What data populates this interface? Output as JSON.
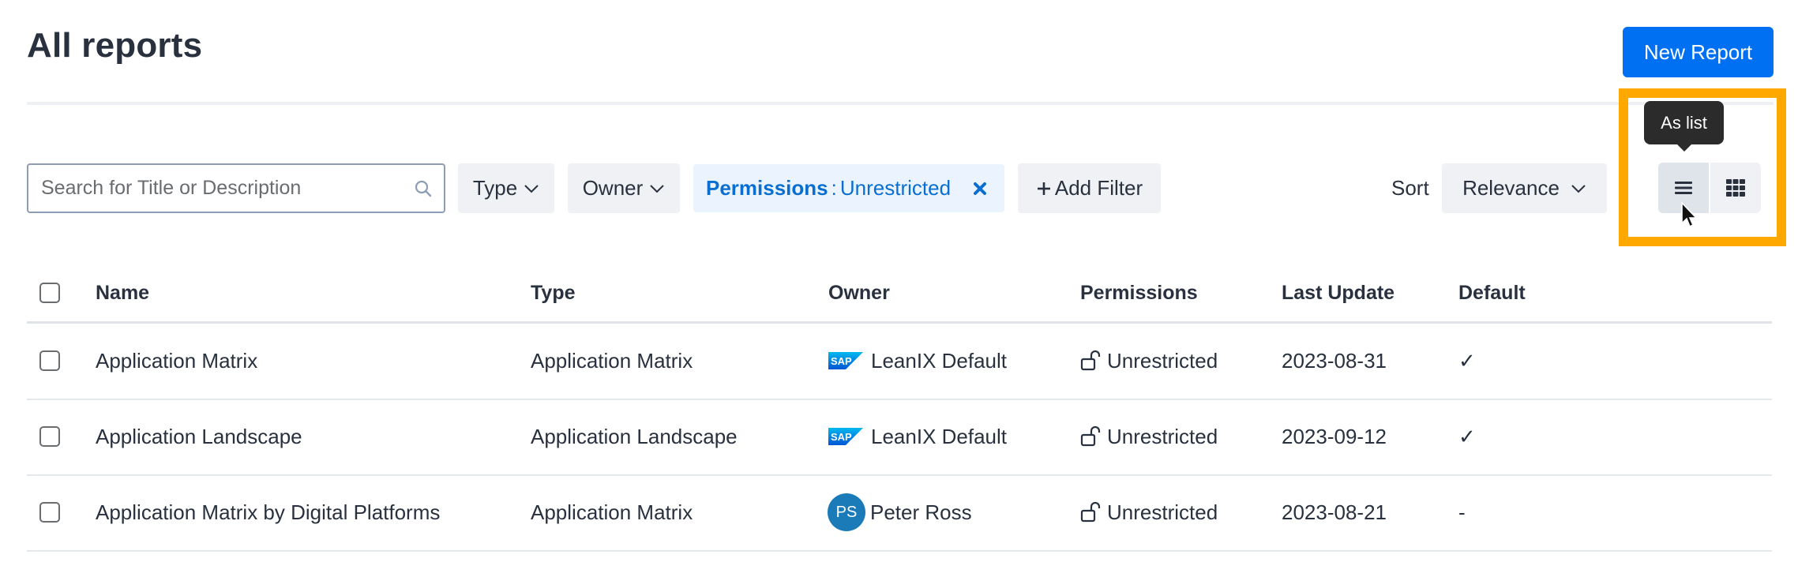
{
  "header": {
    "title": "All reports",
    "new_report_label": "New Report"
  },
  "toolbar": {
    "search_placeholder": "Search for Title or Description",
    "search_value": "",
    "type_filter_label": "Type",
    "owner_filter_label": "Owner",
    "active_filter": {
      "key": "Permissions",
      "separator": ":",
      "value": "Unrestricted"
    },
    "add_filter_label": "Add Filter",
    "sort_label": "Sort",
    "sort_value": "Relevance",
    "view_tooltip": "As list",
    "view_mode": "list",
    "icons": {
      "search": "search-icon",
      "dropdown": "chevron-down-icon",
      "remove": "close-icon",
      "add": "plus-icon",
      "list_view": "list-icon",
      "grid_view": "grid-icon"
    }
  },
  "colors": {
    "primary": "#0070f2",
    "highlight": "#ffa800",
    "chip_text": "#0a6ed1",
    "avatar": "#1a7bb8"
  },
  "table": {
    "columns": [
      "Name",
      "Type",
      "Owner",
      "Permissions",
      "Last Update",
      "Default"
    ],
    "rows": [
      {
        "name": "Application Matrix",
        "type": "Application Matrix",
        "owner": "LeanIX Default",
        "owner_icon": "sap-logo",
        "permissions": "Unrestricted",
        "last_update": "2023-08-31",
        "default": "✓"
      },
      {
        "name": "Application Landscape",
        "type": "Application Landscape",
        "owner": "LeanIX Default",
        "owner_icon": "sap-logo",
        "permissions": "Unrestricted",
        "last_update": "2023-09-12",
        "default": "✓"
      },
      {
        "name": "Application Matrix by Digital Platforms",
        "type": "Application Matrix",
        "owner": "Peter Ross",
        "owner_initials": "PS",
        "permissions": "Unrestricted",
        "last_update": "2023-08-21",
        "default": "-"
      }
    ]
  }
}
